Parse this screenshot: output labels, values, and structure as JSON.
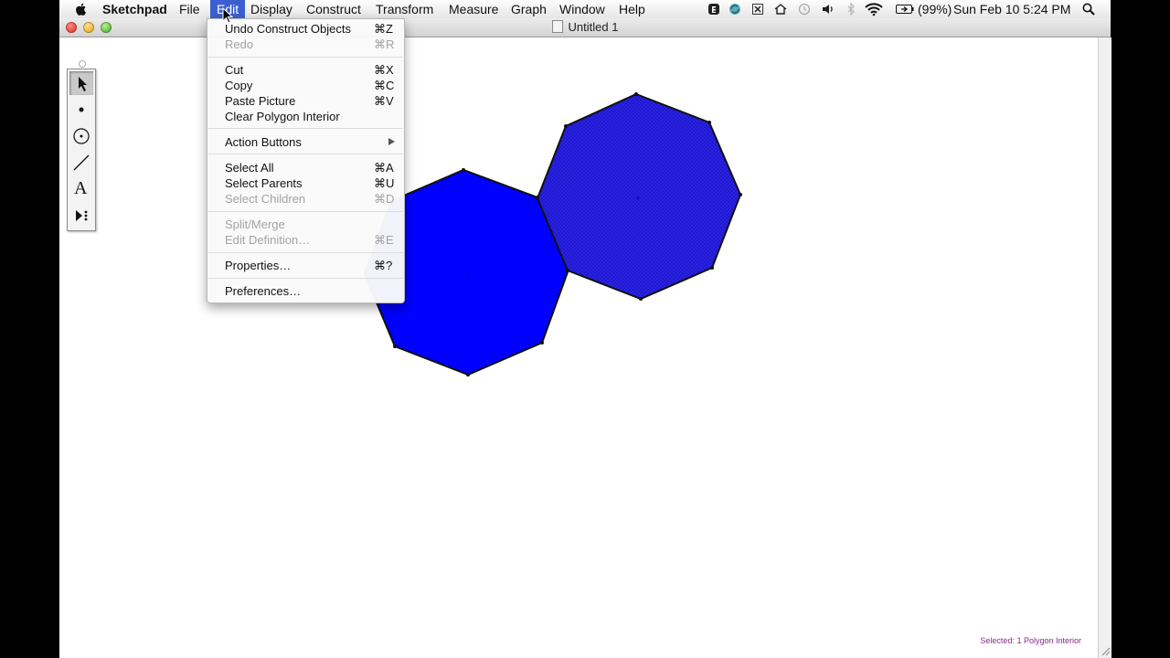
{
  "menubar": {
    "app_name": "Sketchpad",
    "items": [
      "File",
      "Edit",
      "Display",
      "Construct",
      "Transform",
      "Measure",
      "Graph",
      "Window",
      "Help"
    ],
    "active_item": "Edit"
  },
  "status_bar": {
    "battery": "(99%)",
    "datetime": "Sun Feb 10  5:24 PM",
    "icons": [
      "evernote-icon",
      "sync-icon",
      "x-box-icon",
      "home-icon",
      "time-machine-icon",
      "volume-icon",
      "bluetooth-icon",
      "wifi-icon",
      "battery-icon",
      "spotlight-icon"
    ]
  },
  "window": {
    "title": "Untitled 1",
    "selection_status": "Selected: 1 Polygon Interior"
  },
  "toolbox": {
    "tools": [
      "arrow-tool",
      "point-tool",
      "compass-tool",
      "straightedge-tool",
      "text-tool",
      "custom-tool"
    ],
    "selected": "arrow-tool",
    "text_tool_glyph": "A"
  },
  "edit_menu": {
    "items": [
      {
        "label": "Undo Construct Objects",
        "shortcut": "⌘Z",
        "enabled": true
      },
      {
        "label": "Redo",
        "shortcut": "⌘R",
        "enabled": false
      },
      {
        "label": "Cut",
        "shortcut": "⌘X",
        "enabled": true
      },
      {
        "label": "Copy",
        "shortcut": "⌘C",
        "enabled": true
      },
      {
        "label": "Paste Picture",
        "shortcut": "⌘V",
        "enabled": true
      },
      {
        "label": "Clear Polygon Interior",
        "shortcut": "",
        "enabled": true
      },
      {
        "label": "Action Buttons",
        "shortcut": "",
        "enabled": true,
        "submenu": true
      },
      {
        "label": "Select All",
        "shortcut": "⌘A",
        "enabled": true
      },
      {
        "label": "Select Parents",
        "shortcut": "⌘U",
        "enabled": true
      },
      {
        "label": "Select Children",
        "shortcut": "⌘D",
        "enabled": false
      },
      {
        "label": "Split/Merge",
        "shortcut": "",
        "enabled": false
      },
      {
        "label": "Edit Definition…",
        "shortcut": "⌘E",
        "enabled": false
      },
      {
        "label": "Properties…",
        "shortcut": "⌘?",
        "enabled": true
      },
      {
        "label": "Preferences…",
        "shortcut": "",
        "enabled": true
      }
    ]
  },
  "shapes": {
    "fill_color": "#0000ff",
    "selected_fill_color": "#2b24e6",
    "stroke_color": "#000000",
    "polygons": [
      "octagon-left",
      "octagon-right-selected"
    ]
  },
  "colors": {
    "menu_highlight": "#3b5fd0",
    "status_text": "#8a2a8a"
  }
}
